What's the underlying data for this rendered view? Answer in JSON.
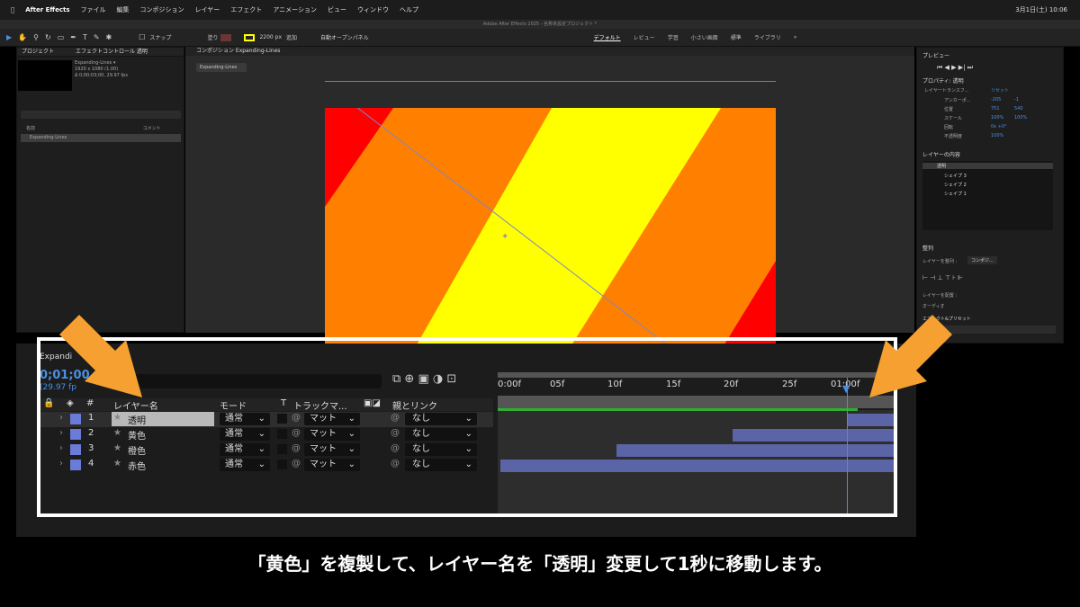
{
  "menubar": {
    "app": "After Effects",
    "items": [
      "ファイル",
      "編集",
      "コンポジション",
      "レイヤー",
      "エフェクト",
      "アニメーション",
      "ビュー",
      "ウィンドウ",
      "ヘルプ"
    ],
    "datetime": "3月1日(土) 10:06"
  },
  "window_title": "Adobe After Effects 2025 - 名称未設定プロジェクト *",
  "toolbar": {
    "snap": "スナップ",
    "fill": "塗り",
    "stroke_width": "2200 px",
    "add": "追加",
    "auto_open": "自動オープンパネル",
    "workspaces": [
      "デフォルト",
      "レビュー",
      "学習",
      "小さい画面",
      "標準",
      "ライブラリ"
    ]
  },
  "project": {
    "tab": "プロジェクト",
    "tab2": "エフェクトコントロール 透明",
    "comp_name": "Expanding-Lines ▾",
    "comp_size": "1920 x 1080 (1.00)",
    "comp_dur": "Δ 0;00;03;00, 29.97 fps",
    "col_name": "名前",
    "col_comment": "コメント",
    "item": "Expanding-Lines"
  },
  "composition": {
    "tab": "コンポジション Expanding-Lines",
    "crumb": "Expanding-Lines"
  },
  "right": {
    "preview": "プレビュー",
    "properties": "プロパティ: 透明",
    "layer_transform": "レイヤートランスフ...",
    "reset": "リセット",
    "anchor": "アンカーポ...",
    "anchor_x": "-205",
    "anchor_y": "-1",
    "position": "位置",
    "pos_x": "751",
    "pos_y": "540",
    "scale": "スケール",
    "scale_x": "100%",
    "scale_y": "100%",
    "rotation": "回転",
    "rot_v": "0x +0°",
    "opacity": "不透明度",
    "op_v": "100%",
    "contents": "レイヤーの内容",
    "content_items": [
      "透明",
      "シェイプ 3",
      "シェイプ 2",
      "シェイプ 1"
    ],
    "align": "整列",
    "align_to": "レイヤーを整列 :",
    "align_target": "コンポジ...",
    "distribute": "レイヤーを配置 :",
    "audio": "オーディオ",
    "effects": "エフェクト&プリセット"
  },
  "timeline": {
    "comp": "Expandi",
    "timecode": "0;01;00",
    "fps": "(29.97 fp",
    "col_name": "レイヤー名",
    "col_mode": "モード",
    "col_t": "T",
    "col_track": "トラックマ...",
    "col_parent": "親とリンク",
    "ticks": [
      "0:00f",
      "05f",
      "10f",
      "15f",
      "20f",
      "25f",
      "01:00f"
    ],
    "layers": [
      {
        "num": "1",
        "name": "透明",
        "mode": "通常",
        "matte": "マット",
        "parent": "なし"
      },
      {
        "num": "2",
        "name": "黄色",
        "mode": "通常",
        "matte": "マット",
        "parent": "なし"
      },
      {
        "num": "3",
        "name": "橙色",
        "mode": "通常",
        "matte": "マット",
        "parent": "なし"
      },
      {
        "num": "4",
        "name": "赤色",
        "mode": "通常",
        "matte": "マット",
        "parent": "なし"
      }
    ]
  },
  "caption": "「黄色」を複製して、レイヤー名を「透明」変更して1秒に移動します。",
  "colors": {
    "orange": "#ff8000",
    "yellow": "#ffff00",
    "red": "#ff0000",
    "label": "#6a7bd8",
    "arrow": "#f5a030"
  }
}
